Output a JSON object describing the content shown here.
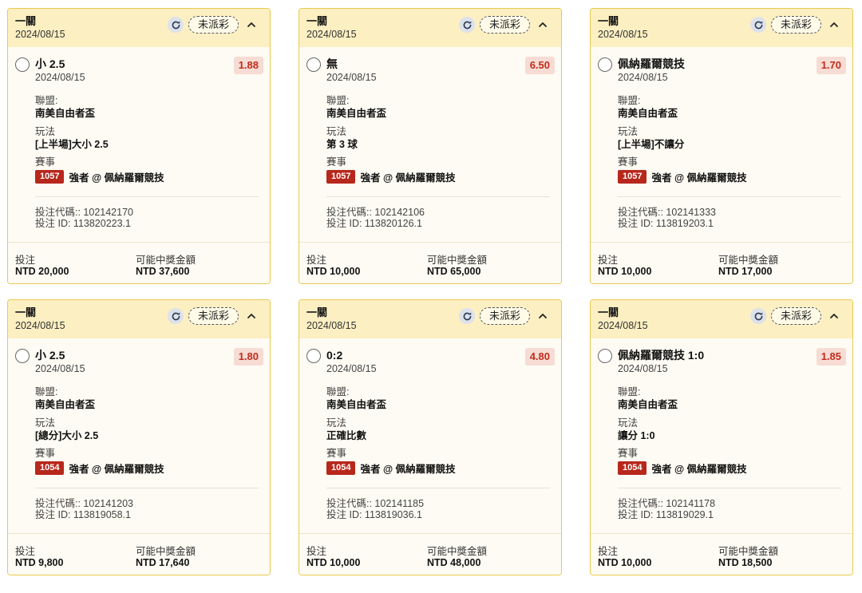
{
  "cards": [
    {
      "type_label": "一關",
      "header_date": "2024/08/15",
      "status": "未派彩",
      "selection": "小 2.5",
      "selection_date": "2024/08/15",
      "odds": "1.88",
      "league_label": "聯盟:",
      "league": "南美自由者盃",
      "market_label": "玩法",
      "market": "[上半場]大小 2.5",
      "event_label": "賽事",
      "match_code": "1057",
      "match_name": "強者 @ 佩納羅爾競技",
      "bet_code": "投注代碼:: 102142170",
      "bet_id": "投注 ID: 113820223.1",
      "stake_label": "投注",
      "stake": "NTD 20,000",
      "payout_label": "可能中獎金額",
      "payout": "NTD 37,600"
    },
    {
      "type_label": "一關",
      "header_date": "2024/08/15",
      "status": "未派彩",
      "selection": "無",
      "selection_date": "2024/08/15",
      "odds": "6.50",
      "league_label": "聯盟:",
      "league": "南美自由者盃",
      "market_label": "玩法",
      "market": "第 3 球",
      "event_label": "賽事",
      "match_code": "1057",
      "match_name": "強者 @ 佩納羅爾競技",
      "bet_code": "投注代碼:: 102142106",
      "bet_id": "投注 ID: 113820126.1",
      "stake_label": "投注",
      "stake": "NTD 10,000",
      "payout_label": "可能中獎金額",
      "payout": "NTD 65,000"
    },
    {
      "type_label": "一關",
      "header_date": "2024/08/15",
      "status": "未派彩",
      "selection": "佩納羅爾競技",
      "selection_date": "2024/08/15",
      "odds": "1.70",
      "league_label": "聯盟:",
      "league": "南美自由者盃",
      "market_label": "玩法",
      "market": "[上半場]不讓分",
      "event_label": "賽事",
      "match_code": "1057",
      "match_name": "強者 @ 佩納羅爾競技",
      "bet_code": "投注代碼:: 102141333",
      "bet_id": "投注 ID: 113819203.1",
      "stake_label": "投注",
      "stake": "NTD 10,000",
      "payout_label": "可能中獎金額",
      "payout": "NTD 17,000"
    },
    {
      "type_label": "一關",
      "header_date": "2024/08/15",
      "status": "未派彩",
      "selection": "小 2.5",
      "selection_date": "2024/08/15",
      "odds": "1.80",
      "league_label": "聯盟:",
      "league": "南美自由者盃",
      "market_label": "玩法",
      "market": "[總分]大小 2.5",
      "event_label": "賽事",
      "match_code": "1054",
      "match_name": "強者 @ 佩納羅爾競技",
      "bet_code": "投注代碼:: 102141203",
      "bet_id": "投注 ID: 113819058.1",
      "stake_label": "投注",
      "stake": "NTD 9,800",
      "payout_label": "可能中獎金額",
      "payout": "NTD 17,640"
    },
    {
      "type_label": "一關",
      "header_date": "2024/08/15",
      "status": "未派彩",
      "selection": "0:2",
      "selection_date": "2024/08/15",
      "odds": "4.80",
      "league_label": "聯盟:",
      "league": "南美自由者盃",
      "market_label": "玩法",
      "market": "正確比數",
      "event_label": "賽事",
      "match_code": "1054",
      "match_name": "強者 @ 佩納羅爾競技",
      "bet_code": "投注代碼:: 102141185",
      "bet_id": "投注 ID: 113819036.1",
      "stake_label": "投注",
      "stake": "NTD 10,000",
      "payout_label": "可能中獎金額",
      "payout": "NTD 48,000"
    },
    {
      "type_label": "一關",
      "header_date": "2024/08/15",
      "status": "未派彩",
      "selection": "佩納羅爾競技 1:0",
      "selection_date": "2024/08/15",
      "odds": "1.85",
      "league_label": "聯盟:",
      "league": "南美自由者盃",
      "market_label": "玩法",
      "market": "讓分 1:0",
      "event_label": "賽事",
      "match_code": "1054",
      "match_name": "強者 @ 佩納羅爾競技",
      "bet_code": "投注代碼:: 102141178",
      "bet_id": "投注 ID: 113819029.1",
      "stake_label": "投注",
      "stake": "NTD 10,000",
      "payout_label": "可能中獎金額",
      "payout": "NTD 18,500"
    }
  ]
}
